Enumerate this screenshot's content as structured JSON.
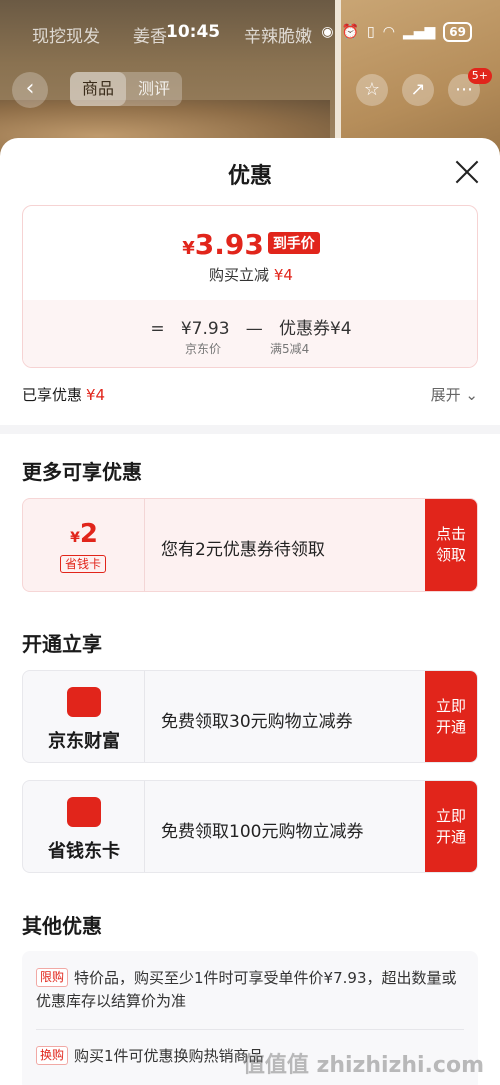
{
  "status": {
    "time": "10:45",
    "battery": "69"
  },
  "backdrop": {
    "tabs": [
      "现挖现发",
      "姜香",
      "辛辣脆嫩"
    ],
    "segments": [
      "商品",
      "测评"
    ],
    "cart_badge": "5+"
  },
  "sheet": {
    "title": "优惠"
  },
  "price": {
    "yen": "¥",
    "final": "3.93",
    "final_tag": "到手价",
    "reduce_label": "购买立减",
    "reduce_value": "¥4",
    "eq": "=",
    "jd_price": "¥7.93",
    "jd_label": "京东价",
    "minus": "—",
    "coupon_label": "优惠券",
    "coupon_value": "¥4",
    "coupon_rule": "满5减4"
  },
  "enjoyed": {
    "label": "已享优惠",
    "value": "¥4",
    "expand": "展开"
  },
  "more": {
    "title": "更多可享优惠",
    "coupon": {
      "yen": "¥",
      "amount": "2",
      "tag": "省钱卡",
      "text": "您有2元优惠券待领取",
      "button": "点击领取"
    }
  },
  "open": {
    "title": "开通立享",
    "items": [
      {
        "name": "京东财富",
        "text": "免费领取30元购物立减券",
        "button": "立即开通"
      },
      {
        "name": "省钱东卡",
        "text": "免费领取100元购物立减券",
        "button": "立即开通"
      }
    ]
  },
  "other": {
    "title": "其他优惠",
    "items": [
      {
        "tag": "限购",
        "text": "特价品，购买至少1件时可享受单件价¥7.93，超出数量或优惠库存以结算价为准"
      },
      {
        "tag": "换购",
        "text": "购买1件可优惠换购热销商品"
      }
    ]
  },
  "watermark": "值值值 zhizhizhi.com",
  "colors": {
    "accent": "#e1251b",
    "card_bg": "#f8f8fa",
    "coupon_bg": "#fdf1f1"
  }
}
